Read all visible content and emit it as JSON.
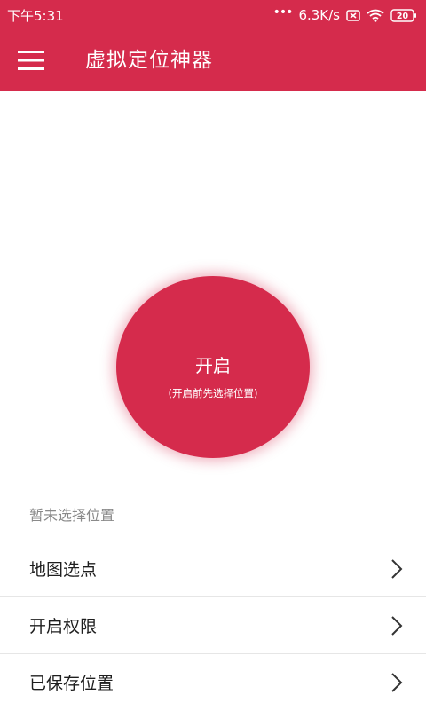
{
  "status_bar": {
    "time": "下午5:31",
    "network_speed": "6.3K/s",
    "battery_level": "20",
    "icons": [
      "signal-dots-icon",
      "sim-blocked-icon",
      "wifi-icon",
      "battery-icon"
    ]
  },
  "app_bar": {
    "title": "虚拟定位神器",
    "menu_icon": "hamburger-menu-icon"
  },
  "start_button": {
    "label": "开启",
    "hint": "(开启前先选择位置)"
  },
  "location_status": "暂未选择位置",
  "menu_items": [
    {
      "label": "地图选点",
      "icon": "chevron-right-icon"
    },
    {
      "label": "开启权限",
      "icon": "chevron-right-icon"
    },
    {
      "label": "已保存位置",
      "icon": "chevron-right-icon"
    }
  ],
  "colors": {
    "primary": "#d52b4c",
    "text_primary": "#1e1e1e",
    "text_secondary": "#8a8a8a",
    "divider": "#e6e6e6"
  }
}
